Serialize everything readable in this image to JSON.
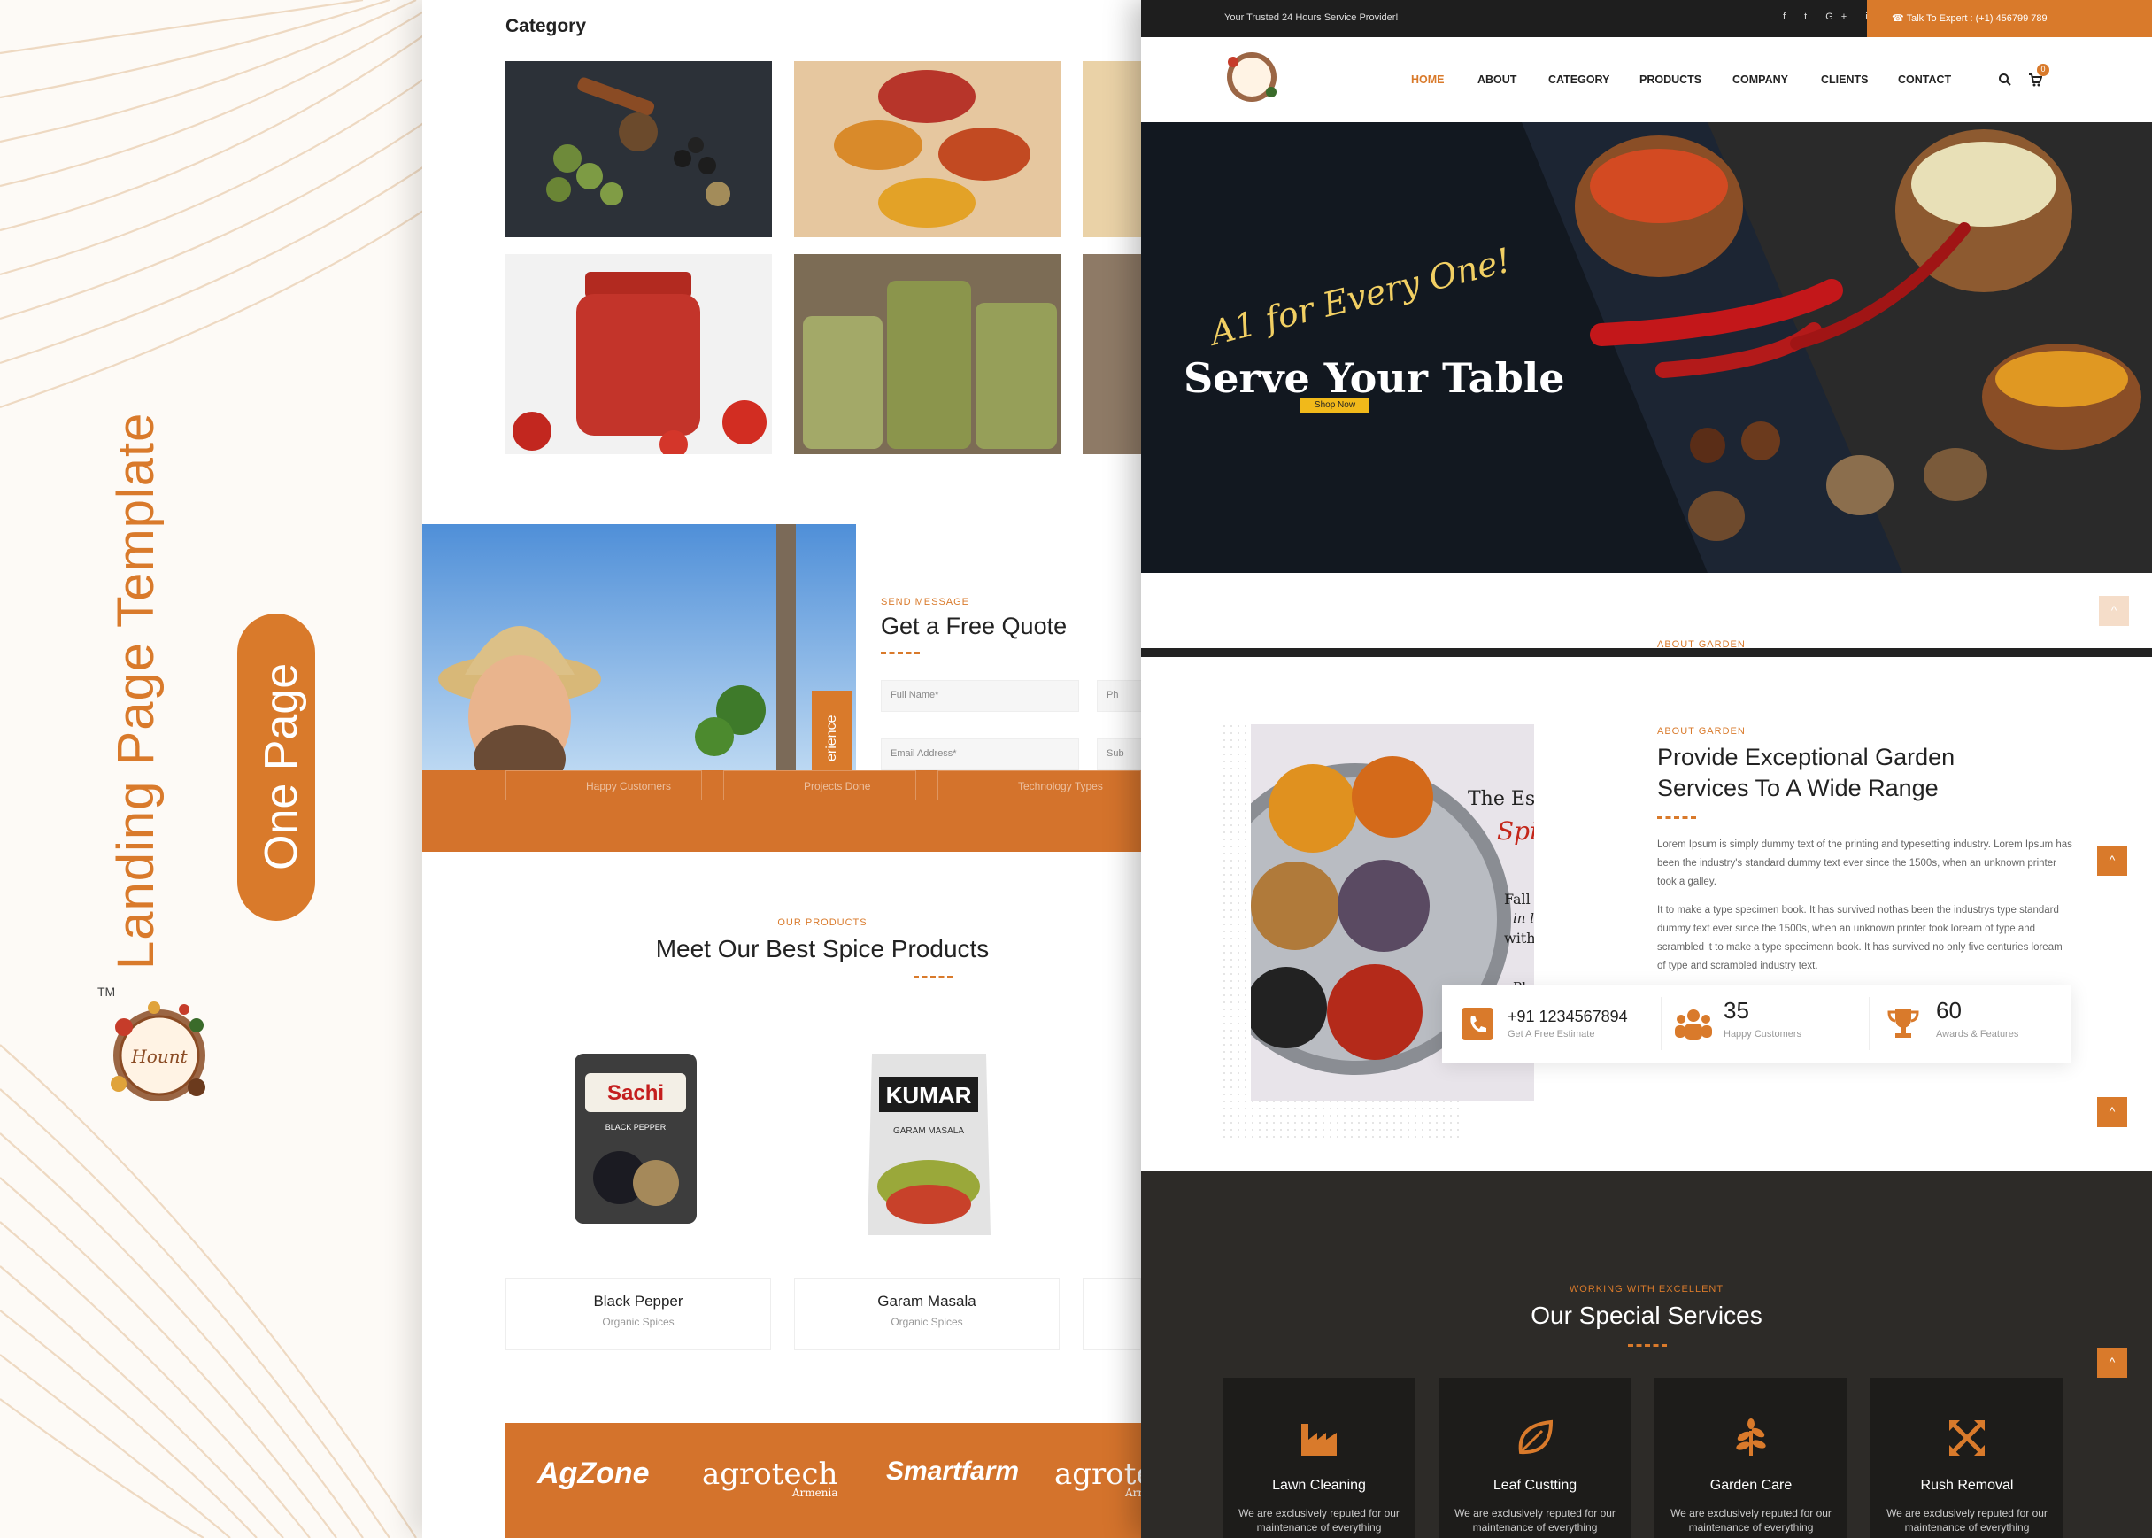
{
  "sidebar": {
    "title": "Landing Page Template",
    "badge": "One Page",
    "logo_text": "Hount",
    "tm": "TM"
  },
  "left": {
    "category_heading": "Category",
    "quote": {
      "kicker": "SEND MESSAGE",
      "title": "Get a Free Quote",
      "full_name": "Full Name*",
      "email": "Email Address*",
      "phone": "Ph",
      "subject": "Sub",
      "experience": "erience"
    },
    "strip": [
      "Happy Customers",
      "Projects Done",
      "Technology Types"
    ],
    "products": {
      "kicker": "OUR PRODUCTS",
      "title": "Meet Our Best Spice Products",
      "items": [
        {
          "name": "Black Pepper",
          "sub": "Organic Spices",
          "brand": "Sachi",
          "label": "BLACK PEPPER"
        },
        {
          "name": "Garam Masala",
          "sub": "Organic Spices",
          "brand": "KUMAR",
          "label": "GARAM MASALA"
        }
      ]
    },
    "brands": [
      "AgZone",
      "agrotech",
      "Smartfarm",
      "agrotec"
    ],
    "brand_subs": [
      "Armenia",
      "Armenia"
    ]
  },
  "right": {
    "topbar": {
      "trusted": "Your Trusted 24 Hours Service Provider!",
      "social": "f  t  G+  in",
      "expert": "Talk To Expert : (+1) 456799 789"
    },
    "nav": [
      "HOME",
      "ABOUT",
      "CATEGORY",
      "PRODUCTS",
      "COMPANY",
      "CLIENTS",
      "CONTACT"
    ],
    "cart_count": "0",
    "hero": {
      "tagline": "A1 for Every One!",
      "title": "Serve Your Table",
      "cta": "Shop Now"
    },
    "about": {
      "kicker": "ABOUT GARDEN",
      "ghost_kicker": "ABOUT GARDEN",
      "title_1": "Provide Exceptional Garden",
      "title_2": "Services To A Wide Range",
      "para1": "Lorem Ipsum is simply dummy text of the printing and typesetting industry. Lorem Ipsum has been the industry's standard dummy text ever since the 1500s, when an unknown printer took a galley.",
      "para2": "It to make a type specimen book. It has survived nothas been the industrys type standard dummy text ever since the 1500s, when an unknown printer took loream of type and scrambled it to make a type specimenn book. It has survived no only five centuries loream of type and scrambled industry text.",
      "image_caption": {
        "l1": "The Essential",
        "l2": "Spices...",
        "l3": "Fall",
        "l4": "in love",
        "l5": "with them !",
        "l6": "Photos."
      },
      "phone": "+91 1234567894",
      "phone_sub": "Get A Free Estimate",
      "stat1_value": "35",
      "stat1_label": "Happy Customers",
      "stat2_value": "60",
      "stat2_label": "Awards & Features"
    },
    "services": {
      "kicker": "WORKING WITH EXCELLENT",
      "title": "Our Special Services",
      "items": [
        {
          "name": "Lawn Cleaning",
          "desc": "We are exclusively reputed for our maintenance of everything"
        },
        {
          "name": "Leaf Custting",
          "desc": "We are exclusively reputed for our maintenance of everything"
        },
        {
          "name": "Garden Care",
          "desc": "We are exclusively reputed for our maintenance of everything"
        },
        {
          "name": "Rush Removal",
          "desc": "We are exclusively reputed for our maintenance of everything"
        }
      ]
    }
  },
  "colors": {
    "accent": "#d97a2b",
    "dark": "#1e1e1e",
    "services_bg": "#2d2b28"
  }
}
